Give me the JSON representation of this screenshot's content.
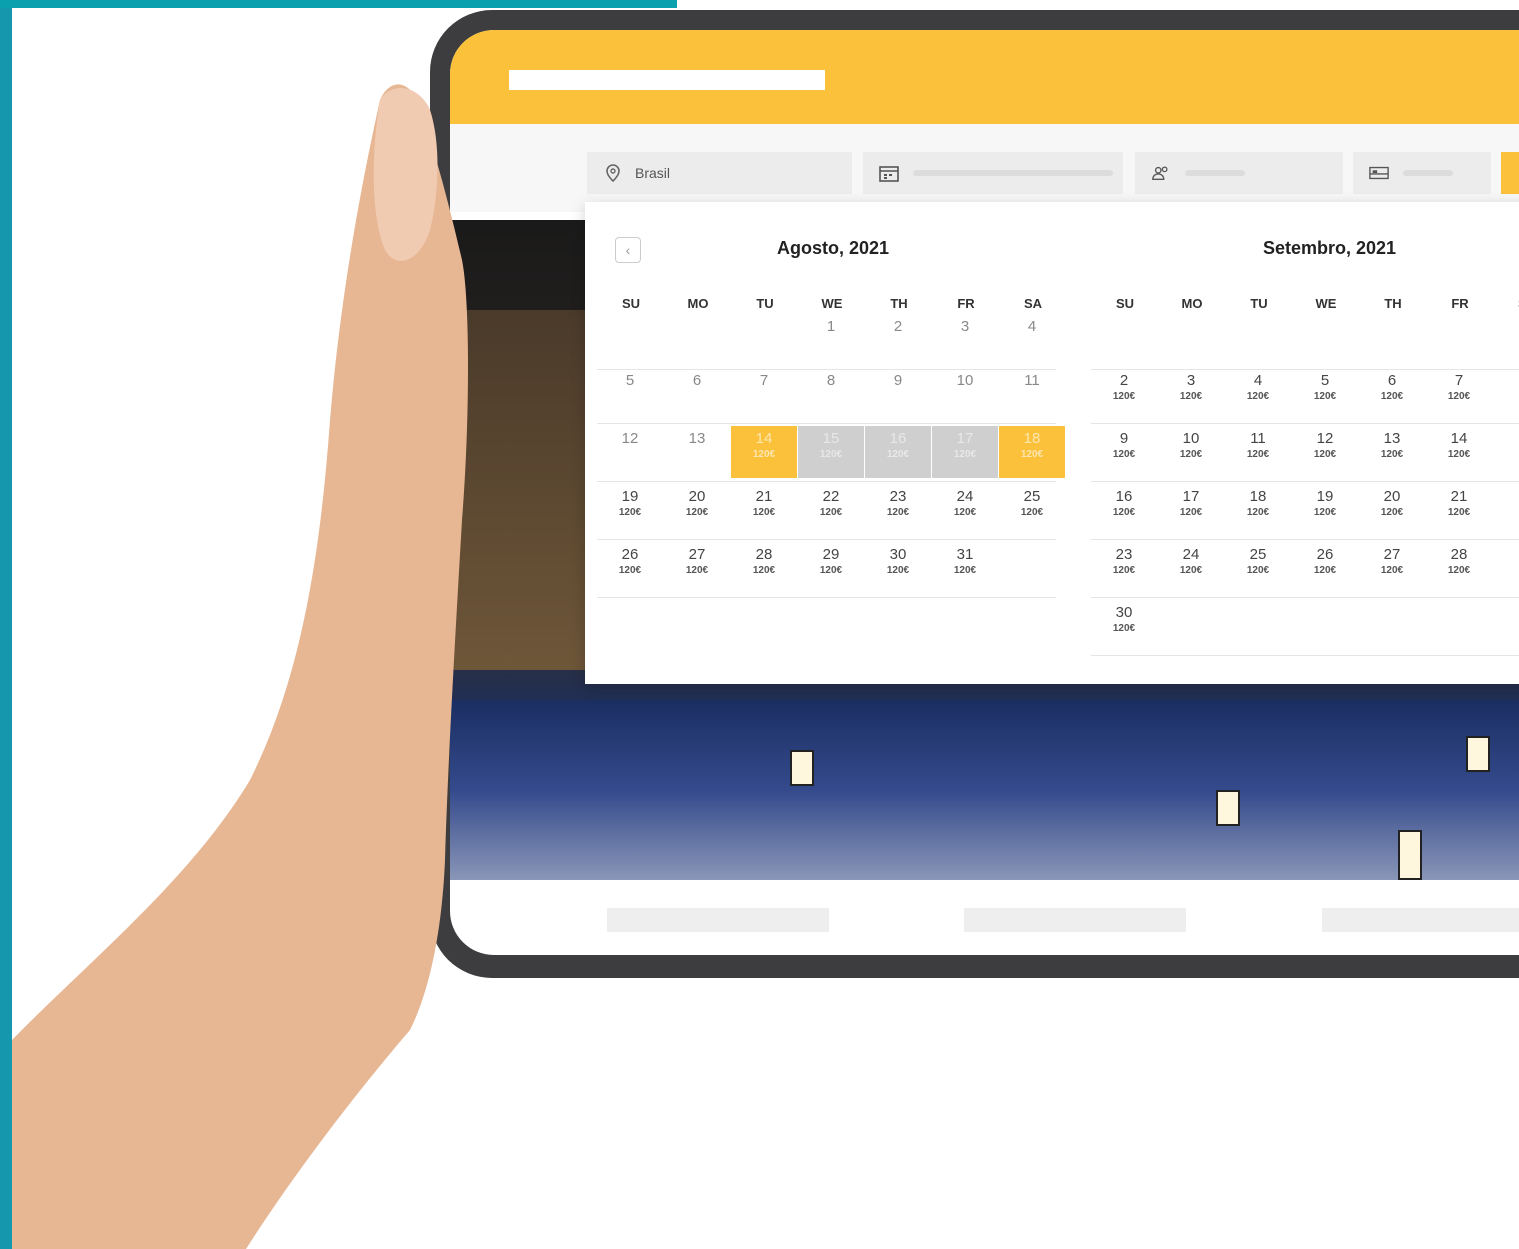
{
  "search": {
    "destination": "Brasil"
  },
  "calendar": {
    "prev_label": "‹",
    "months": [
      {
        "title": "Agosto, 2021",
        "weekdays": [
          "SU",
          "MO",
          "TU",
          "WE",
          "TH",
          "FR",
          "SA"
        ],
        "weeks": [
          [
            null,
            null,
            null,
            {
              "d": "1"
            },
            {
              "d": "2"
            },
            {
              "d": "3"
            },
            {
              "d": "4"
            }
          ],
          [
            {
              "d": "5"
            },
            {
              "d": "6"
            },
            {
              "d": "7"
            },
            {
              "d": "8"
            },
            {
              "d": "9"
            },
            {
              "d": "10"
            },
            {
              "d": "11"
            }
          ],
          [
            {
              "d": "12"
            },
            {
              "d": "13"
            },
            {
              "d": "14",
              "p": "120€",
              "s": "end"
            },
            {
              "d": "15",
              "p": "120€",
              "s": "mid"
            },
            {
              "d": "16",
              "p": "120€",
              "s": "mid"
            },
            {
              "d": "17",
              "p": "120€",
              "s": "mid"
            },
            {
              "d": "18",
              "p": "120€",
              "s": "end"
            }
          ],
          [
            {
              "d": "19",
              "p": "120€"
            },
            {
              "d": "20",
              "p": "120€"
            },
            {
              "d": "21",
              "p": "120€"
            },
            {
              "d": "22",
              "p": "120€"
            },
            {
              "d": "23",
              "p": "120€"
            },
            {
              "d": "24",
              "p": "120€"
            },
            {
              "d": "25",
              "p": "120€"
            }
          ],
          [
            {
              "d": "26",
              "p": "120€"
            },
            {
              "d": "27",
              "p": "120€"
            },
            {
              "d": "28",
              "p": "120€"
            },
            {
              "d": "29",
              "p": "120€"
            },
            {
              "d": "30",
              "p": "120€"
            },
            {
              "d": "31",
              "p": "120€"
            },
            null
          ]
        ]
      },
      {
        "title": "Setembro, 2021",
        "weekdays": [
          "SU",
          "MO",
          "TU",
          "WE",
          "TH",
          "FR",
          "SA"
        ],
        "weeks": [
          [
            null,
            null,
            null,
            null,
            null,
            null,
            null
          ],
          [
            {
              "d": "2",
              "p": "120€"
            },
            {
              "d": "3",
              "p": "120€"
            },
            {
              "d": "4",
              "p": "120€"
            },
            {
              "d": "5",
              "p": "120€"
            },
            {
              "d": "6",
              "p": "120€"
            },
            {
              "d": "7",
              "p": "120€"
            },
            null
          ],
          [
            {
              "d": "9",
              "p": "120€"
            },
            {
              "d": "10",
              "p": "120€"
            },
            {
              "d": "11",
              "p": "120€"
            },
            {
              "d": "12",
              "p": "120€"
            },
            {
              "d": "13",
              "p": "120€"
            },
            {
              "d": "14",
              "p": "120€"
            },
            null
          ],
          [
            {
              "d": "16",
              "p": "120€"
            },
            {
              "d": "17",
              "p": "120€"
            },
            {
              "d": "18",
              "p": "120€"
            },
            {
              "d": "19",
              "p": "120€"
            },
            {
              "d": "20",
              "p": "120€"
            },
            {
              "d": "21",
              "p": "120€"
            },
            null
          ],
          [
            {
              "d": "23",
              "p": "120€"
            },
            {
              "d": "24",
              "p": "120€"
            },
            {
              "d": "25",
              "p": "120€"
            },
            {
              "d": "26",
              "p": "120€"
            },
            {
              "d": "27",
              "p": "120€"
            },
            {
              "d": "28",
              "p": "120€"
            },
            null
          ],
          [
            {
              "d": "30",
              "p": "120€"
            },
            null,
            null,
            null,
            null,
            null,
            null
          ]
        ]
      }
    ]
  },
  "colors": {
    "accent": "#fcc13a",
    "range": "#cfcfcf",
    "teal": "#1597ae"
  }
}
